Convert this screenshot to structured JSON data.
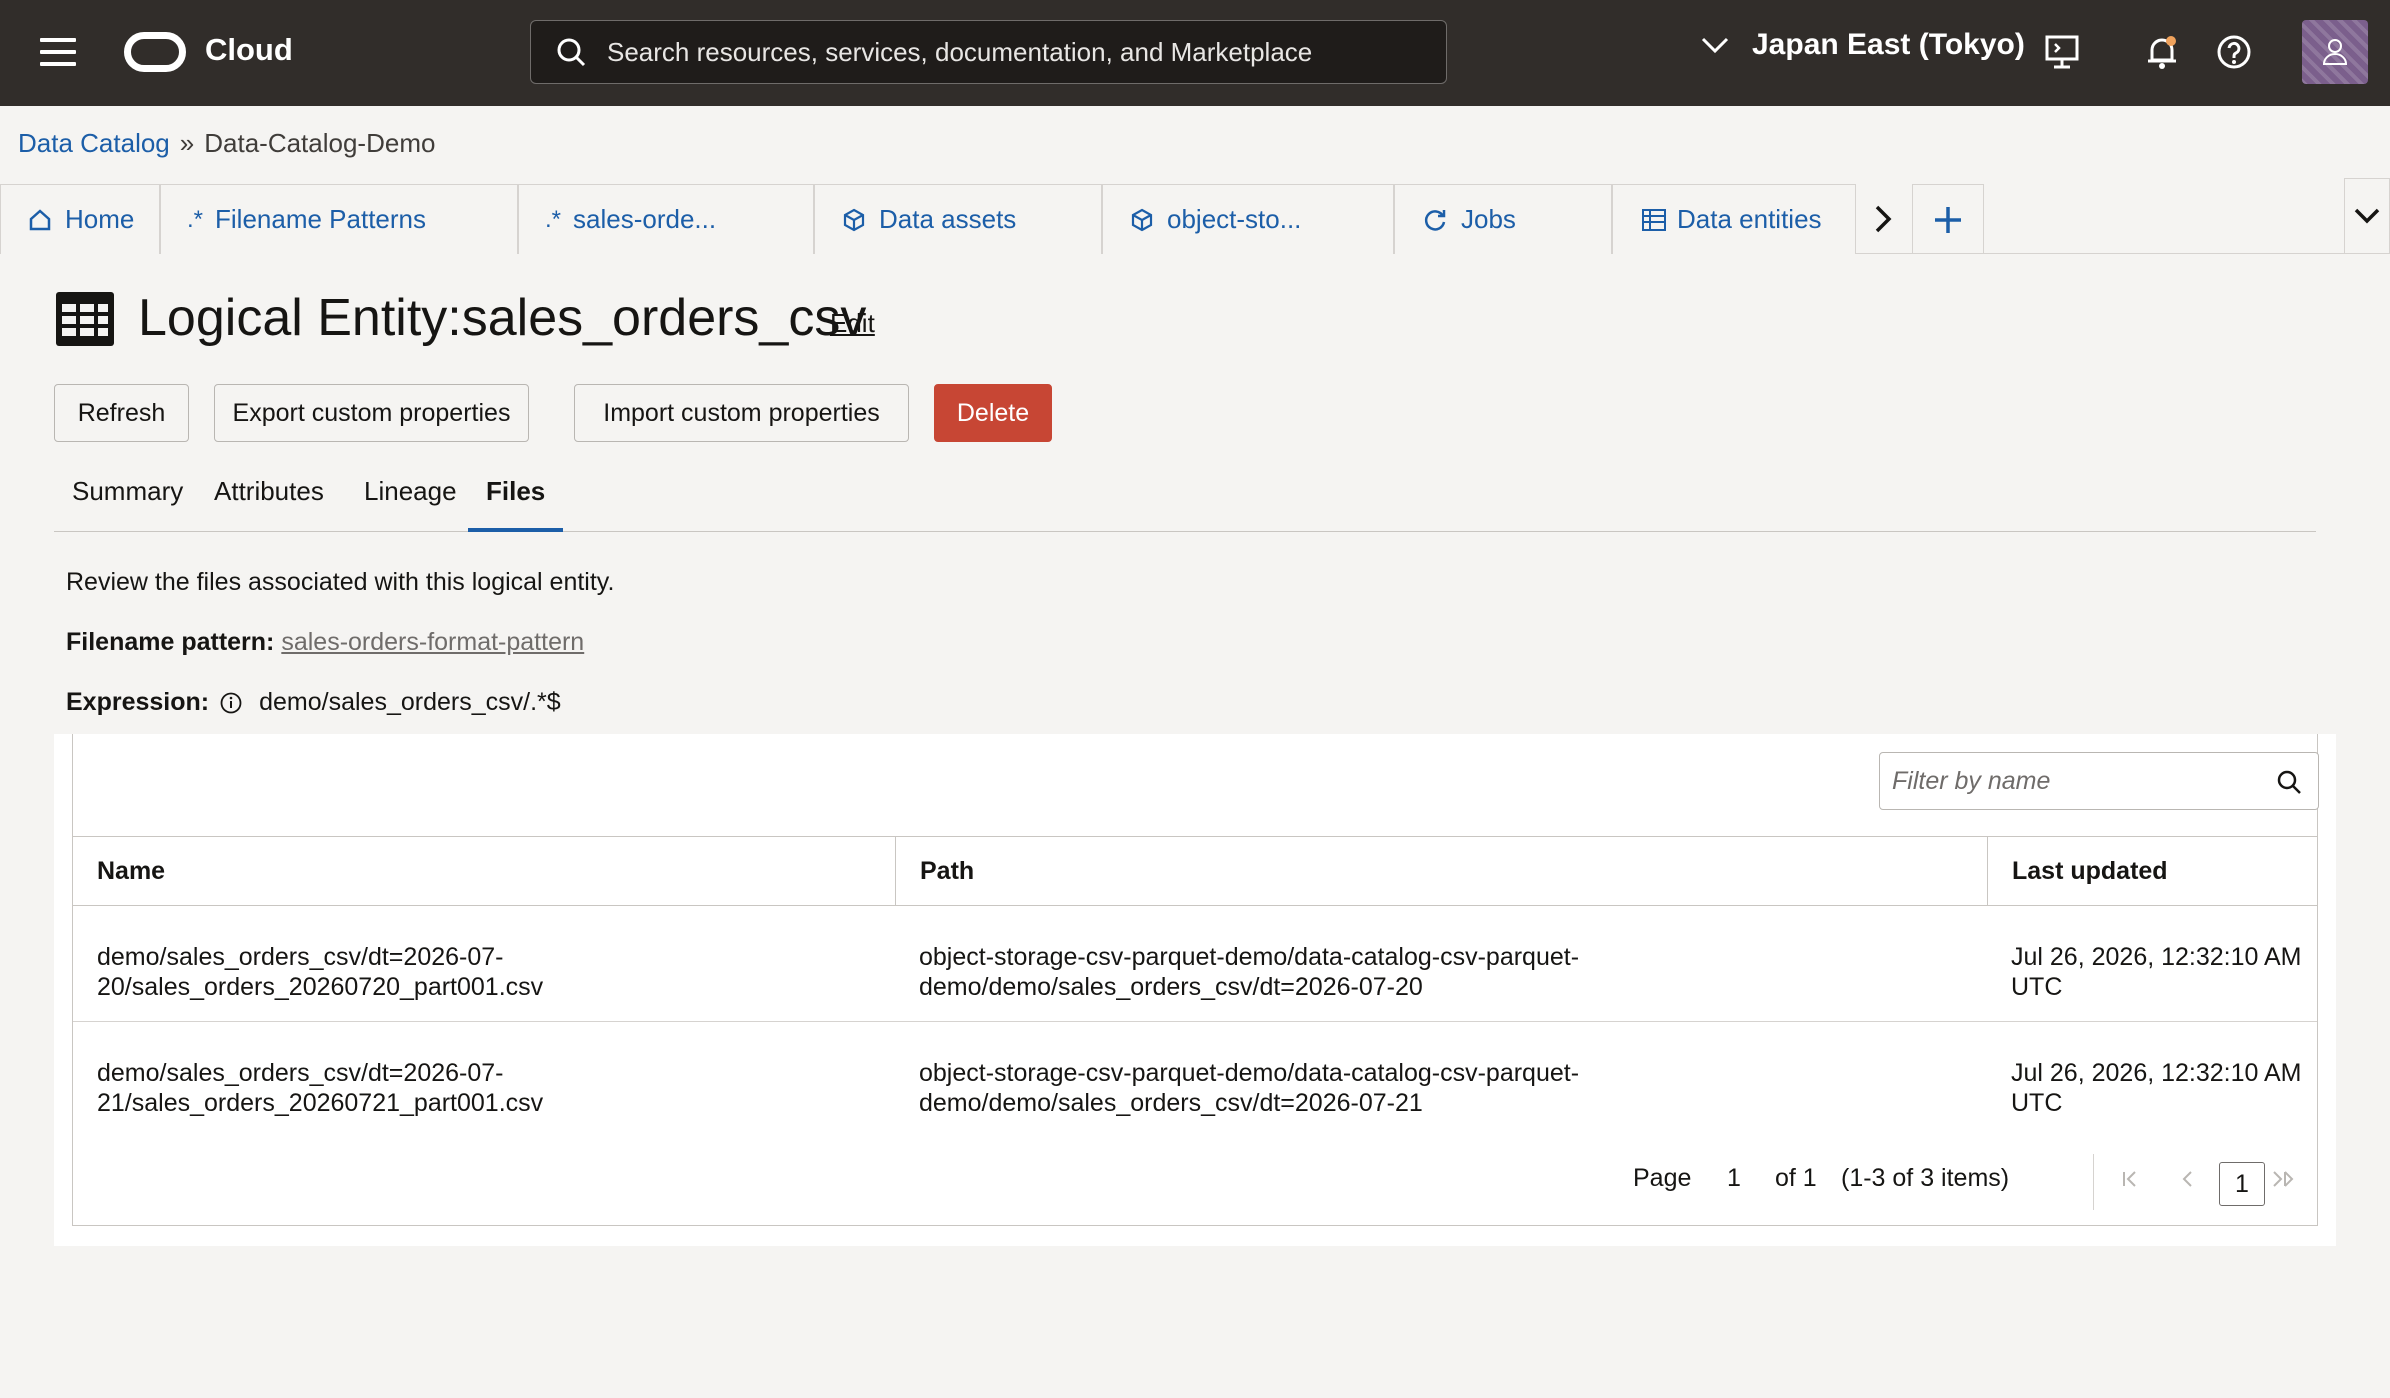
{
  "header": {
    "brand": "Cloud",
    "search_placeholder": "Search resources, services, documentation, and Marketplace",
    "region": "Japan East (Tokyo)"
  },
  "breadcrumb": {
    "root": "Data Catalog",
    "separator": "»",
    "current": "Data-Catalog-Demo"
  },
  "tabs": [
    {
      "label": "Home",
      "icon": "home-icon"
    },
    {
      "label": "Filename Patterns",
      "icon": "regex-icon"
    },
    {
      "label": "sales-orde...",
      "icon": "regex-icon"
    },
    {
      "label": "Data assets",
      "icon": "cube-icon"
    },
    {
      "label": "object-sto...",
      "icon": "cube-icon"
    },
    {
      "label": "Jobs",
      "icon": "refresh-icon"
    },
    {
      "label": "Data entities",
      "icon": "table-icon"
    }
  ],
  "page": {
    "title": "Logical Entity:sales_orders_csv",
    "edit_label": "Edit"
  },
  "actions": {
    "refresh": "Refresh",
    "export": "Export custom properties",
    "import": "Import custom properties",
    "delete": "Delete"
  },
  "subtabs": [
    "Summary",
    "Attributes",
    "Lineage",
    "Files"
  ],
  "active_subtab": "Files",
  "files_info": {
    "description": "Review the files associated with this logical entity.",
    "pattern_label": "Filename pattern:",
    "pattern_value": "sales-orders-format-pattern",
    "expression_label": "Expression:",
    "expression_value": "demo/sales_orders_csv/.*$"
  },
  "table": {
    "filter_placeholder": "Filter by name",
    "columns": [
      "Name",
      "Path",
      "Last updated"
    ],
    "rows": [
      {
        "name": "demo/sales_orders_csv/dt=2026-07-\n20/sales_orders_20260720_part001.csv",
        "path": "object-storage-csv-parquet-demo/data-catalog-csv-parquet-\ndemo/demo/sales_orders_csv/dt=2026-07-20",
        "updated": "Jul 26, 2026, 12:32:10 AM\nUTC"
      },
      {
        "name": "demo/sales_orders_csv/dt=2026-07-\n21/sales_orders_20260721_part001.csv",
        "path": "object-storage-csv-parquet-demo/data-catalog-csv-parquet-\ndemo/demo/sales_orders_csv/dt=2026-07-21",
        "updated": "Jul 26, 2026, 12:32:10 AM\nUTC"
      }
    ]
  },
  "pagination": {
    "page_label": "Page",
    "page_value": "1",
    "of_label": "of 1",
    "items_label": "(1-3 of 3 items)",
    "current_page": "1"
  },
  "colors": {
    "topbar": "#312d2a",
    "link": "#1c5ea8",
    "danger": "#c74634",
    "background": "#f5f4f2"
  }
}
